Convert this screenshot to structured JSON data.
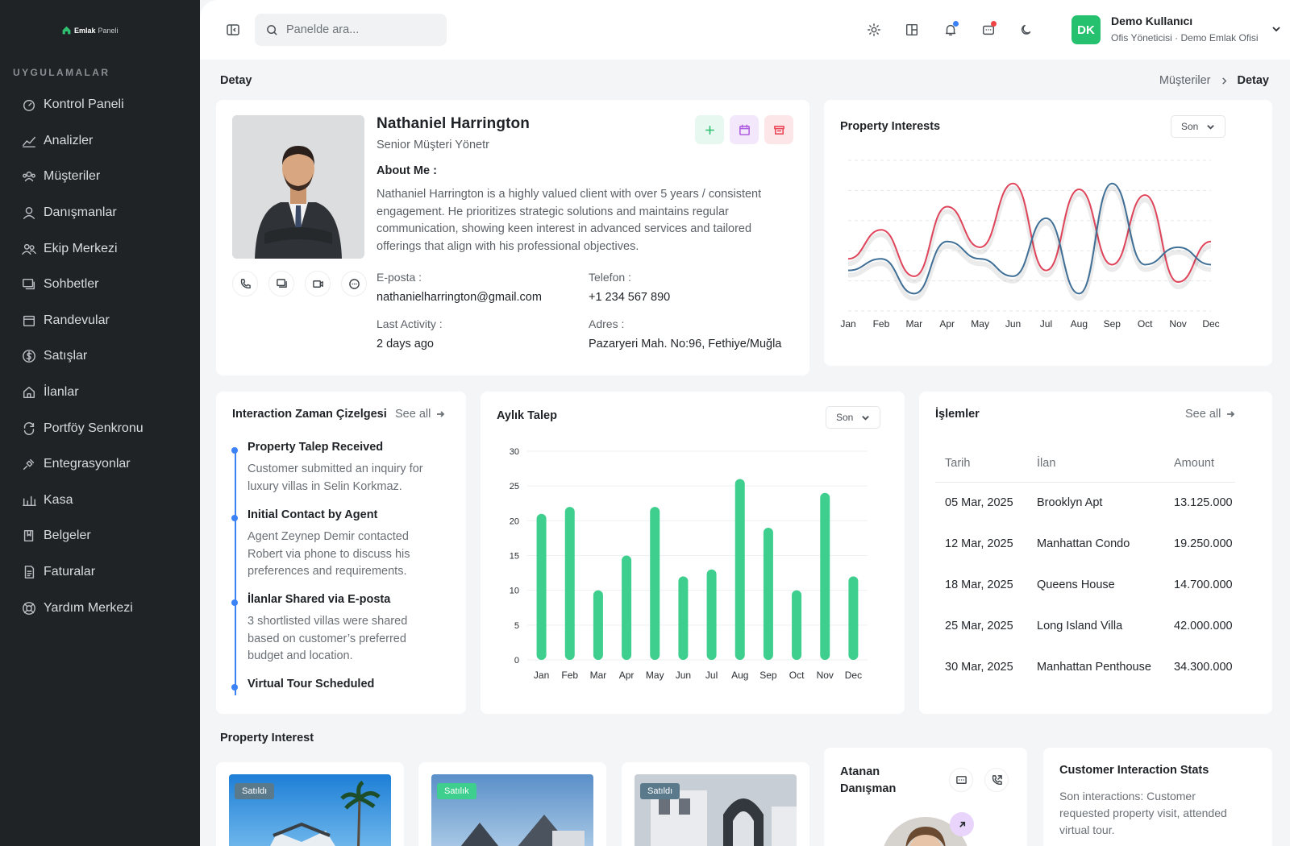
{
  "brand": {
    "name_bold": "Emlak",
    "name_light": "Paneli"
  },
  "sidebar": {
    "section": "UYGULAMALAR",
    "items": [
      {
        "label": "Kontrol Paneli",
        "icon": "dashboard-icon"
      },
      {
        "label": "Analizler",
        "icon": "analytics-icon"
      },
      {
        "label": "Müşteriler",
        "icon": "customers-icon"
      },
      {
        "label": "Danışmanlar",
        "icon": "user-icon"
      },
      {
        "label": "Ekip Merkezi",
        "icon": "team-icon"
      },
      {
        "label": "Sohbetler",
        "icon": "chat-icon"
      },
      {
        "label": "Randevular",
        "icon": "calendar-icon"
      },
      {
        "label": "Satışlar",
        "icon": "dollar-icon"
      },
      {
        "label": "İlanlar",
        "icon": "home-icon"
      },
      {
        "label": "Portföy Senkronu",
        "icon": "sync-icon"
      },
      {
        "label": "Entegrasyonlar",
        "icon": "plug-icon"
      },
      {
        "label": "Kasa",
        "icon": "bar-chart-icon"
      },
      {
        "label": "Belgeler",
        "icon": "book-icon"
      },
      {
        "label": "Faturalar",
        "icon": "invoice-icon"
      },
      {
        "label": "Yardım Merkezi",
        "icon": "help-icon"
      }
    ]
  },
  "topbar": {
    "search_placeholder": "Panelde ara...",
    "user_initials": "DK",
    "user_name": "Demo Kullanıcı",
    "user_role": "Ofis Yöneticisi · Demo Emlak Ofisi"
  },
  "page": {
    "title": "Detay",
    "breadcrumb": [
      "Müşteriler",
      "Detay"
    ]
  },
  "profile": {
    "name": "Nathaniel Harrington",
    "role": "Senior Müşteri Yönetr",
    "about_heading": "About Me :",
    "about": "Nathaniel Harrington is a highly valued client with over 5 years / consistent engagement. He prioritizes strategic solutions and maintains regular communication, showing keen interest in advanced services and tailored offerings that align with his professional objectives.",
    "email_label": "E-posta :",
    "email": "nathanielharrington@gmail.com",
    "phone_label": "Telefon :",
    "phone": "+1 234 567 890",
    "activity_label": "Last Activity :",
    "activity": "2 days ago",
    "address_label": "Adres :",
    "address": "Pazaryeri Mah. No:96, Fethiye/Muğla"
  },
  "property_interests": {
    "title": "Property Interests",
    "filter": "Son",
    "chart_data": {
      "type": "line",
      "categories": [
        "Jan",
        "Feb",
        "Mar",
        "Apr",
        "May",
        "Jun",
        "Jul",
        "Aug",
        "Sep",
        "Oct",
        "Nov",
        "Dec"
      ],
      "series": [
        {
          "values": [
            45,
            70,
            30,
            90,
            55,
            110,
            35,
            105,
            40,
            100,
            25,
            60
          ],
          "color": "#e0445a"
        },
        {
          "values": [
            35,
            45,
            15,
            60,
            45,
            30,
            80,
            15,
            110,
            40,
            55,
            40
          ],
          "color": "#3f6f96"
        }
      ],
      "ylim": [
        0,
        130
      ],
      "grid": true
    }
  },
  "timeline": {
    "title": "Interaction Zaman Çizelgesi",
    "see_all": "See all",
    "items": [
      {
        "title": "Property Talep Received",
        "desc": "Customer submitted an inquiry for luxury villas in Selin Korkmaz."
      },
      {
        "title": "Initial Contact by Agent",
        "desc": "Agent Zeynep Demir contacted Robert via phone to discuss his preferences and requirements."
      },
      {
        "title": "İlanlar Shared via E-posta",
        "desc": "3 shortlisted villas were shared based on customer’s preferred budget and location."
      },
      {
        "title": "Virtual Tour Scheduled",
        "desc": ""
      }
    ]
  },
  "monthly": {
    "title": "Aylık Talep",
    "filter": "Son",
    "chart_data": {
      "type": "bar",
      "categories": [
        "Jan",
        "Feb",
        "Mar",
        "Apr",
        "May",
        "Jun",
        "Jul",
        "Aug",
        "Sep",
        "Oct",
        "Nov",
        "Dec"
      ],
      "values": [
        21,
        22,
        10,
        15,
        22,
        12,
        13,
        26,
        19,
        10,
        24,
        12
      ],
      "ylim": [
        0,
        30
      ],
      "yticks": [
        0,
        5,
        10,
        15,
        20,
        25,
        30
      ],
      "color": "#3ecf8e",
      "grid": true
    }
  },
  "transactions": {
    "title": "İşlemler",
    "see_all": "See all",
    "columns": [
      "Tarih",
      "İlan",
      "Amount"
    ],
    "rows": [
      [
        "05 Mar, 2025",
        "Brooklyn Apt",
        "13.125.000 ₺"
      ],
      [
        "12 Mar, 2025",
        "Manhattan Condo",
        "19.250.000 ₺"
      ],
      [
        "18 Mar, 2025",
        "Queens House",
        "14.700.000 ₺"
      ],
      [
        "25 Mar, 2025",
        "Long Island Villa",
        "42.000.000 ₺"
      ],
      [
        "30 Mar, 2025",
        "Manhattan Penthouse",
        "34.300.000 ₺"
      ]
    ]
  },
  "property_interest": {
    "title": "Property Interest",
    "cards": [
      {
        "tag": "Satıldı",
        "tag_color": "#5a7a8c"
      },
      {
        "tag": "Satılık",
        "tag_color": "#3ecf8e"
      },
      {
        "tag": "Satıldı",
        "tag_color": "#5a7a8c"
      }
    ]
  },
  "assigned": {
    "title_line1": "Atanan",
    "title_line2": "Danışman"
  },
  "stats": {
    "title": "Customer Interaction Stats",
    "desc": "Son interactions: Customer requested property visit, attended virtual tour."
  }
}
